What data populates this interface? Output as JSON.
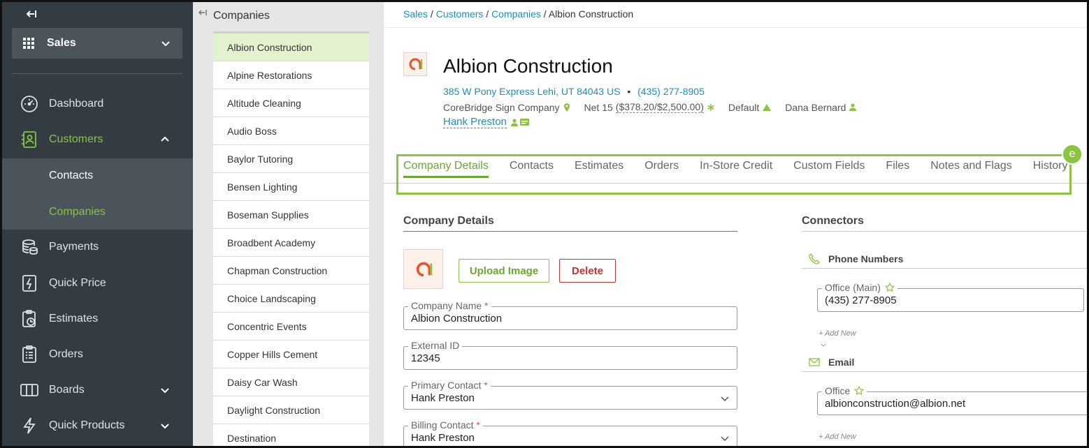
{
  "sidebar": {
    "module": "Sales",
    "nav": [
      {
        "label": "Dashboard",
        "icon": "dashboard-gauge-icon"
      },
      {
        "label": "Customers",
        "icon": "customers-contact-icon",
        "active": true
      },
      {
        "label": "Payments",
        "icon": "payments-coins-icon"
      },
      {
        "label": "Quick Price",
        "icon": "quick-price-icon"
      },
      {
        "label": "Estimates",
        "icon": "estimates-clipboard-icon"
      },
      {
        "label": "Orders",
        "icon": "orders-list-icon"
      },
      {
        "label": "Boards",
        "icon": "boards-columns-icon"
      },
      {
        "label": "Quick Products",
        "icon": "quick-products-bolt-icon"
      }
    ],
    "sub": [
      {
        "label": "Contacts"
      },
      {
        "label": "Companies",
        "active": true
      }
    ]
  },
  "list": {
    "title": "Companies",
    "items": [
      "Albion Construction",
      "Alpine Restorations",
      "Altitude Cleaning",
      "Audio Boss",
      "Baylor Tutoring",
      "Bensen Lighting",
      "Boseman Supplies",
      "Broadbent Academy",
      "Chapman Construction",
      "Choice Landscaping",
      "Concentric Events",
      "Copper Hills Cement",
      "Daisy Car Wash",
      "Daylight Construction",
      "Destination"
    ],
    "selected": "Albion Construction"
  },
  "breadcrumb": {
    "sales": "Sales",
    "customers": "Customers",
    "companies": "Companies",
    "current": "Albion Construction",
    "sep": "/"
  },
  "header": {
    "title": "Albion Construction",
    "address": "385 W Pony Express Lehi, UT 84043 US",
    "dot": "•",
    "phone": "(435) 277-8905",
    "location": "CoreBridge Sign Company",
    "terms": "Net 15",
    "credit": "($378.20/$2,500.00)",
    "tax": "Default",
    "salesperson": "Dana Bernard",
    "contact": "Hank Preston"
  },
  "tabs": [
    "Company Details",
    "Contacts",
    "Estimates",
    "Orders",
    "In-Store Credit",
    "Custom Fields",
    "Files",
    "Notes and Flags",
    "History"
  ],
  "badge": "e",
  "details": {
    "section_title": "Company Details",
    "upload_label": "Upload Image",
    "delete_label": "Delete",
    "fields": [
      {
        "label": "Company Name",
        "required": "*",
        "value": "Albion Construction"
      },
      {
        "label": "External ID",
        "value": "12345"
      },
      {
        "label": "Primary Contact",
        "required": "*",
        "value": "Hank Preston"
      },
      {
        "label": "Billing Contact",
        "required": "*",
        "value": "Hank Preston"
      }
    ]
  },
  "connectors": {
    "section_title": "Connectors",
    "phone_title": "Phone Numbers",
    "phone_label": "Office (Main)",
    "phone_value": "(435) 277-8905",
    "add_new": "+ Add New",
    "email_title": "Email",
    "email_label": "Office",
    "email_value": "albionconstruction@albion.net"
  },
  "colors": {
    "accent": "#8bc53f",
    "link": "#1a8fc4",
    "sidebar": "#333c43",
    "danger": "#c9302c"
  }
}
